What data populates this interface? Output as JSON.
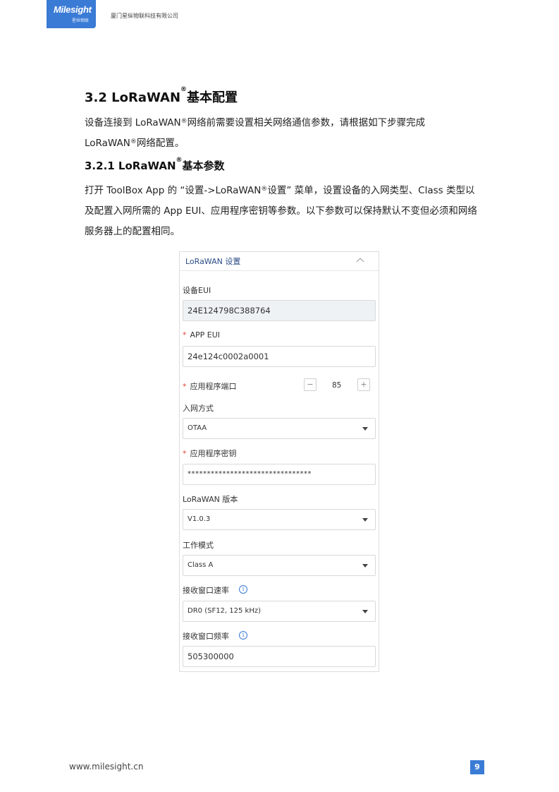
{
  "header": {
    "logo_text": "Milesight",
    "logo_sub": "星纵物联",
    "company": "厦门星纵物联科技有限公司"
  },
  "section": {
    "title": "3.2 LoRaWAN",
    "title_suffix": "基本配置",
    "reg_mark": "®",
    "intro_a": "设备连接到 LoRaWAN",
    "intro_b": "网络前需要设置相关网络通信参数，请根据如下步骤完成 LoRaWAN",
    "intro_c": "网络配置。"
  },
  "subsection": {
    "title": "3.2.1 LoRaWAN",
    "title_suffix": "基本参数",
    "para_a": "打开 ToolBox App 的 “设置->LoRaWAN",
    "para_b": "设置” 菜单，设置设备的入网类型、Class 类型以及配置入网所需的 App EUI、应用程序密钥等参数。以下参数可以保持默认不变但必须和网络服务器上的配置相同。"
  },
  "form": {
    "panel_title": "LoRaWAN 设置",
    "required_mark": "*",
    "device_eui": {
      "label": "设备EUI",
      "value": "24E124798C388764"
    },
    "app_eui": {
      "label": "APP EUI",
      "value": "24e124c0002a0001"
    },
    "app_port": {
      "label": "应用程序端口",
      "value": "85",
      "minus": "−",
      "plus": "+"
    },
    "join_type": {
      "label": "入网方式",
      "value": "OTAA"
    },
    "app_key": {
      "label": "应用程序密钥",
      "value": "********************************"
    },
    "version": {
      "label": "LoRaWAN 版本",
      "value": "V1.0.3"
    },
    "work_mode": {
      "label": "工作模式",
      "value": "Class A"
    },
    "rx2_rate": {
      "label": "接收窗口速率",
      "value": "DR0 (SF12, 125 kHz)"
    },
    "rx2_freq": {
      "label": "接收窗口频率",
      "value": "505300000"
    },
    "info_glyph": "i"
  },
  "footer": {
    "url": "www.milesight.cn",
    "page": "9"
  },
  "colors": {
    "brand": "#3a7bd5",
    "required": "#e0443e",
    "title": "#2b4c86"
  }
}
